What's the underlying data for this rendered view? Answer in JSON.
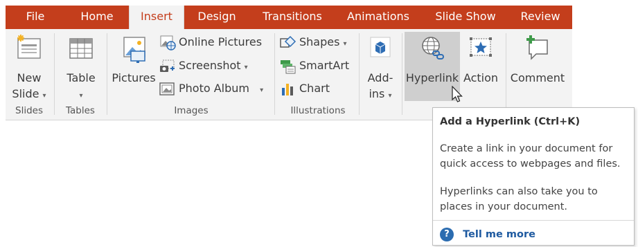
{
  "tabs": [
    {
      "label": "File",
      "active": false
    },
    {
      "label": "Home",
      "active": false
    },
    {
      "label": "Insert",
      "active": true
    },
    {
      "label": "Design",
      "active": false
    },
    {
      "label": "Transitions",
      "active": false
    },
    {
      "label": "Animations",
      "active": false
    },
    {
      "label": "Slide Show",
      "active": false
    },
    {
      "label": "Review",
      "active": false
    }
  ],
  "groups": {
    "slides": {
      "label": "Slides",
      "new_slide": {
        "line1": "New",
        "line2": "Slide",
        "caret": "▾",
        "icon": "new-slide-icon"
      }
    },
    "tables": {
      "label": "Tables",
      "table": {
        "line1": "Table",
        "caret": "▾",
        "icon": "table-icon"
      }
    },
    "images": {
      "label": "Images",
      "pictures": {
        "label": "Pictures",
        "icon": "pictures-icon"
      },
      "online_pictures": {
        "label": "Online Pictures",
        "icon": "online-pictures-icon"
      },
      "screenshot": {
        "label": "Screenshot",
        "caret": "▾",
        "icon": "screenshot-icon"
      },
      "photo_album": {
        "label": "Photo Album",
        "caret": "▾",
        "icon": "photo-album-icon"
      }
    },
    "illustrations": {
      "label": "Illustrations",
      "shapes": {
        "label": "Shapes",
        "caret": "▾",
        "icon": "shapes-icon"
      },
      "smartart": {
        "label": "SmartArt",
        "icon": "smartart-icon"
      },
      "chart": {
        "label": "Chart",
        "icon": "chart-icon"
      }
    },
    "addins": {
      "line1": "Add-",
      "line2": "ins",
      "caret": "▾",
      "icon": "store-icon"
    },
    "links": {
      "hyperlink": {
        "label": "Hyperlink",
        "icon": "hyperlink-globe-icon"
      },
      "action": {
        "label": "Action",
        "icon": "action-star-icon"
      }
    },
    "comments": {
      "comment": {
        "label": "Comment",
        "icon": "comment-icon"
      }
    }
  },
  "tooltip": {
    "title": "Add a Hyperlink (Ctrl+K)",
    "para1_line1": "Create a link in your document for",
    "para1_line2": "quick access to webpages and files.",
    "para2_line1": "Hyperlinks can also take you to",
    "para2_line2": "places in your document.",
    "tell_me_more": "Tell me more",
    "help_glyph": "?"
  },
  "colors": {
    "accent": "#c43e1c",
    "ribbon_bg": "#f3f3f3",
    "hover_bg": "#cfcfcf",
    "link_blue": "#1e5aa0"
  }
}
